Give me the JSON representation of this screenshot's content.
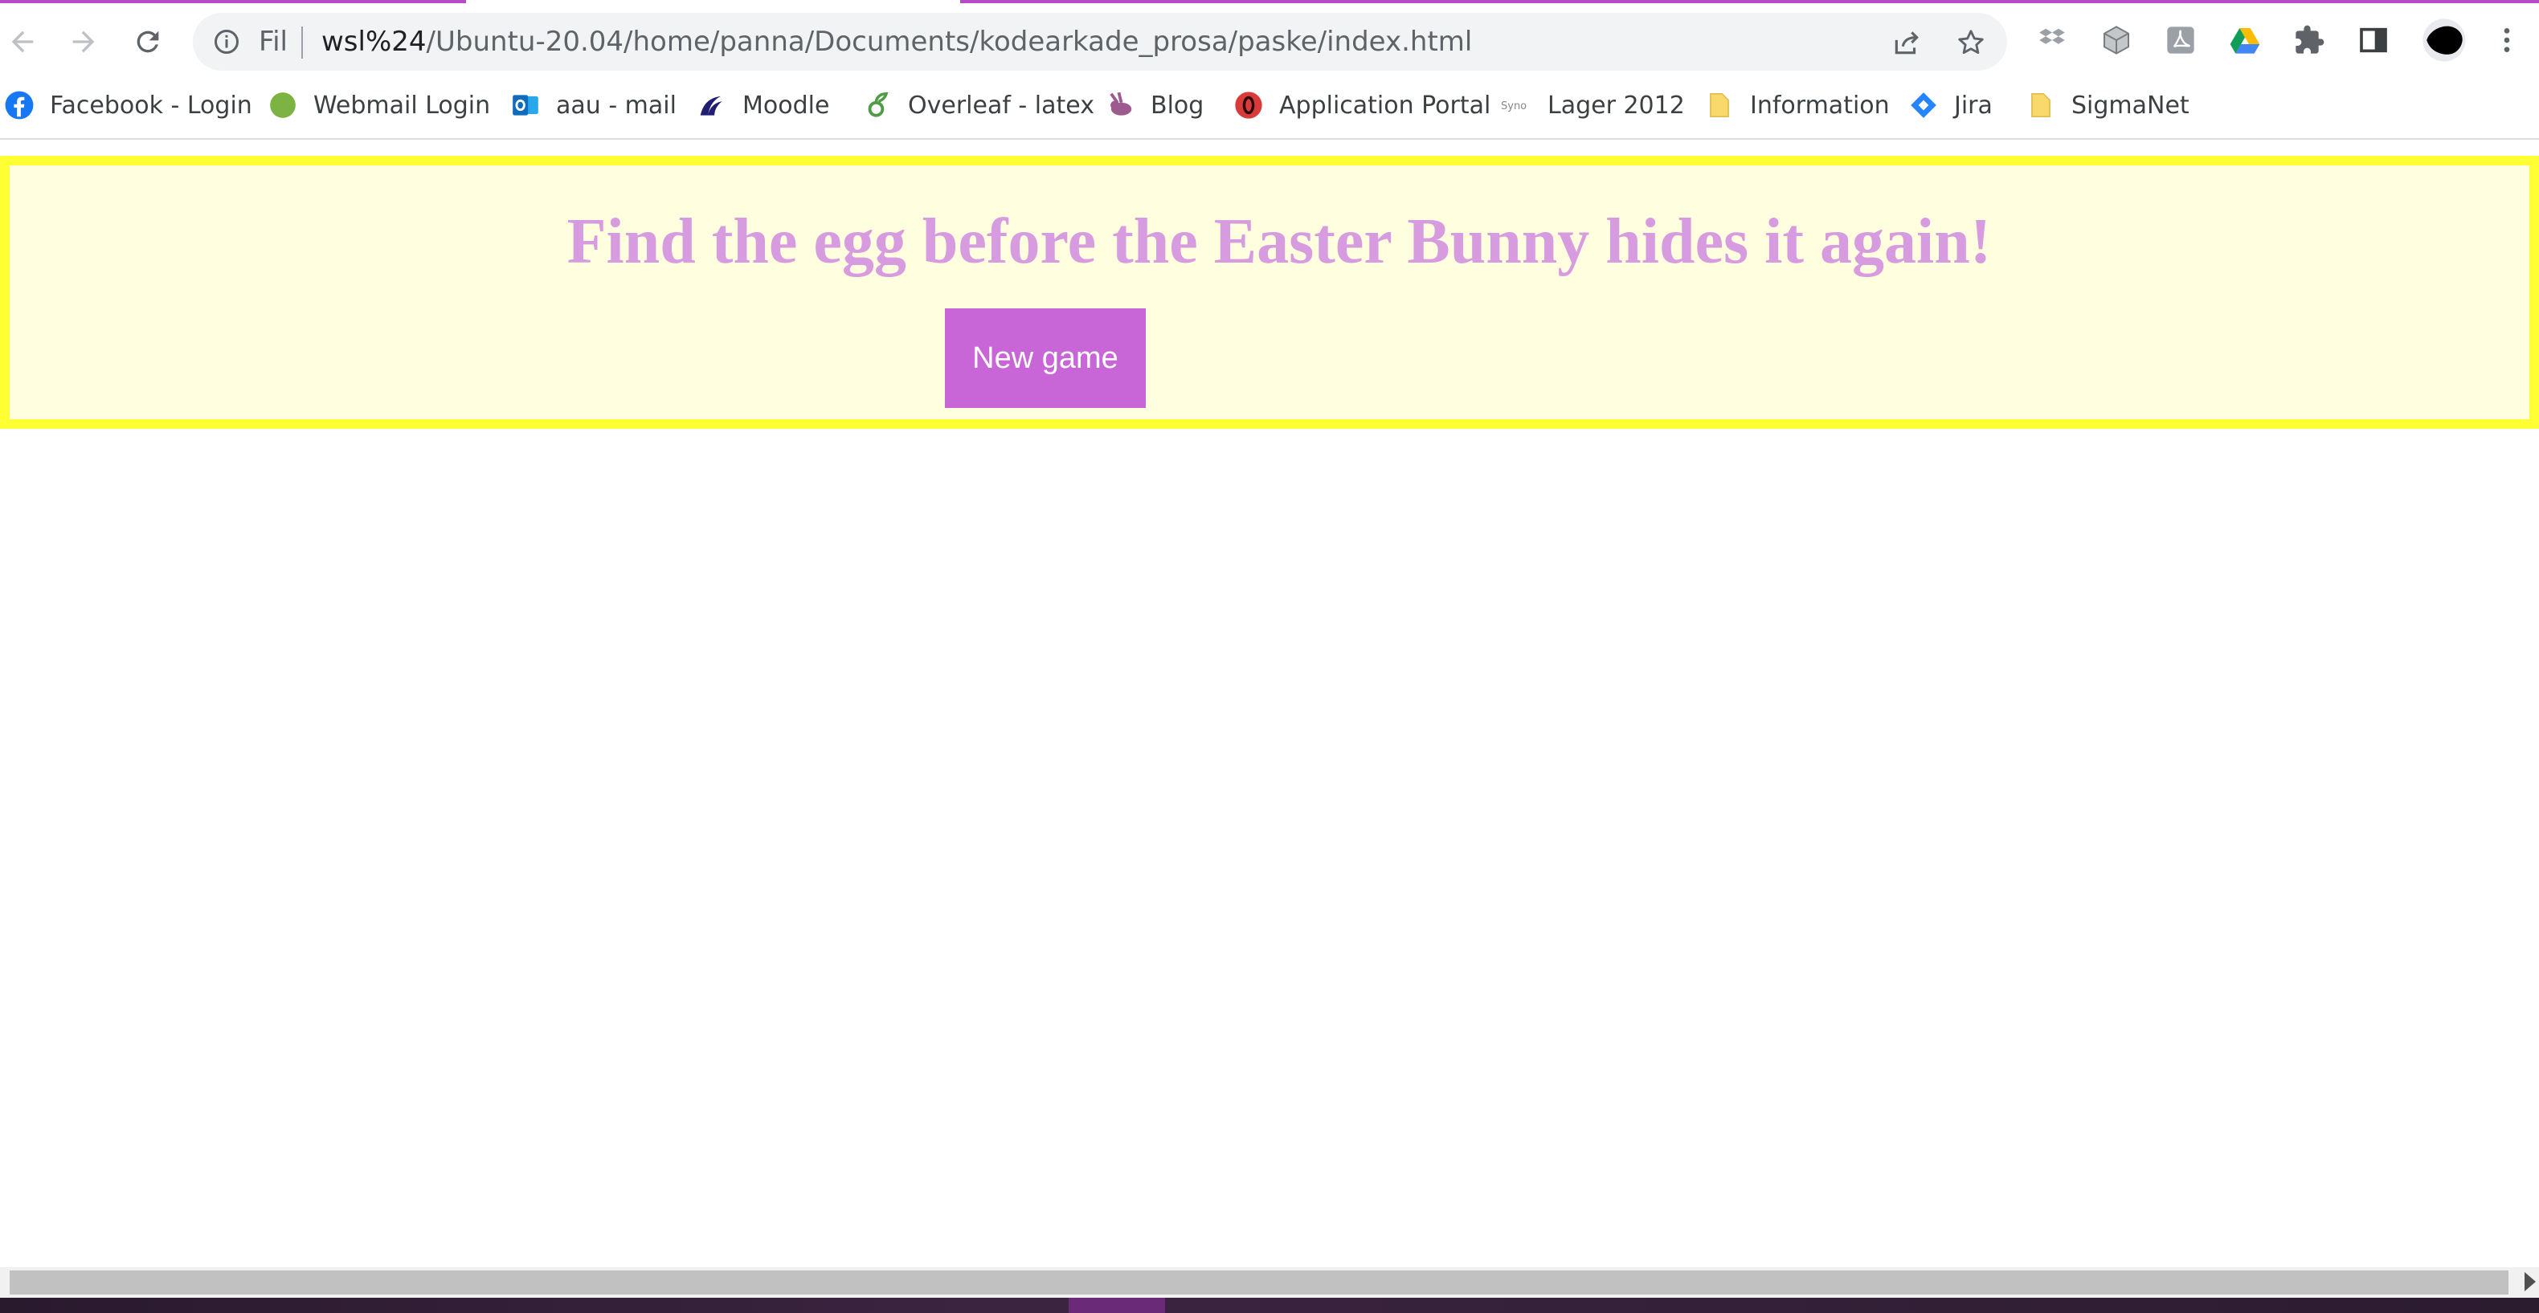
{
  "browser": {
    "address": {
      "scheme_label": "Fil",
      "url_host": "wsl%24",
      "url_path": "/Ubuntu-20.04/home/panna/Documents/kodearkade_prosa/paske/index.html"
    },
    "nav": {
      "back_icon": "arrow-left-icon",
      "forward_icon": "arrow-right-icon",
      "reload_icon": "reload-icon"
    }
  },
  "bookmarks": [
    {
      "label": "Facebook - Login",
      "icon": "facebook-icon",
      "color": "#1877f2"
    },
    {
      "label": "Webmail Login",
      "icon": "green-circle-icon",
      "color": "#7cb342"
    },
    {
      "label": "aau - mail",
      "icon": "outlook-icon",
      "color": "#0f6cbd"
    },
    {
      "label": "Moodle",
      "icon": "moodle-icon",
      "color": "#211d70"
    },
    {
      "label": "Overleaf - latex",
      "icon": "overleaf-icon",
      "color": "#4f9c45"
    },
    {
      "label": "Blog",
      "icon": "bunny-icon",
      "color": "#9c5a8f"
    },
    {
      "label": "Application Portal",
      "icon": "portal-icon",
      "color": "#d93a3a"
    },
    {
      "label": "Lager 2012",
      "icon": "synology-icon",
      "color": "#888888"
    },
    {
      "label": "Information",
      "icon": "folder-icon",
      "color": "#f9d96b"
    },
    {
      "label": "Jira",
      "icon": "jira-icon",
      "color": "#2684ff"
    },
    {
      "label": "SigmaNet",
      "icon": "folder-icon",
      "color": "#f9d96b"
    }
  ],
  "page": {
    "title": "Find the egg before the Easter Bunny hides it again!",
    "new_game_label": "New game",
    "colors": {
      "banner_background": "#ffffe0",
      "banner_border": "#ffff33",
      "title": "#d79be0",
      "button": "#c866d8"
    }
  }
}
